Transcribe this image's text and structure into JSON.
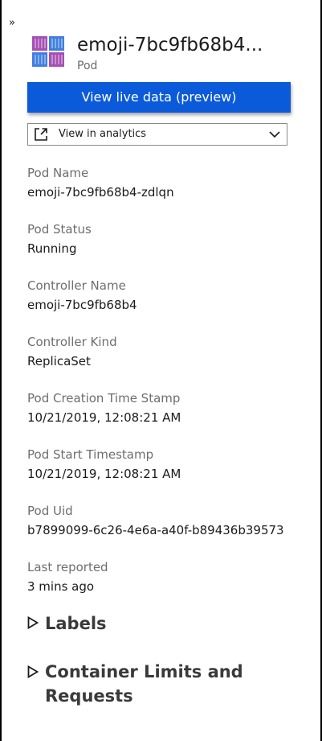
{
  "panel": {
    "collapse_glyph": "»",
    "title": "emoji-7bc9fb68b4...",
    "subtitle": "Pod",
    "icon": "pod-icon"
  },
  "actions": {
    "live_label": "View live data (preview)",
    "analytics_label": "View in analytics",
    "analytics_icon": "external-link-icon"
  },
  "properties": [
    {
      "label": "Pod Name",
      "value": "emoji-7bc9fb68b4-zdlqn"
    },
    {
      "label": "Pod Status",
      "value": "Running"
    },
    {
      "label": "Controller Name",
      "value": "emoji-7bc9fb68b4"
    },
    {
      "label": "Controller Kind",
      "value": "ReplicaSet"
    },
    {
      "label": "Pod Creation Time Stamp",
      "value": "10/21/2019, 12:08:21 AM"
    },
    {
      "label": "Pod Start Timestamp",
      "value": "10/21/2019, 12:08:21 AM"
    },
    {
      "label": "Pod Uid",
      "value": "b7899099-6c26-4e6a-a40f-b89436b39573"
    },
    {
      "label": "Last reported",
      "value": "3 mins ago"
    }
  ],
  "sections": {
    "labels": "Labels",
    "limits": "Container Limits and Requests"
  },
  "colors": {
    "accent": "#0b5ad9",
    "icon_blue": "#3f7fe0",
    "icon_purple": "#a64fb5"
  }
}
